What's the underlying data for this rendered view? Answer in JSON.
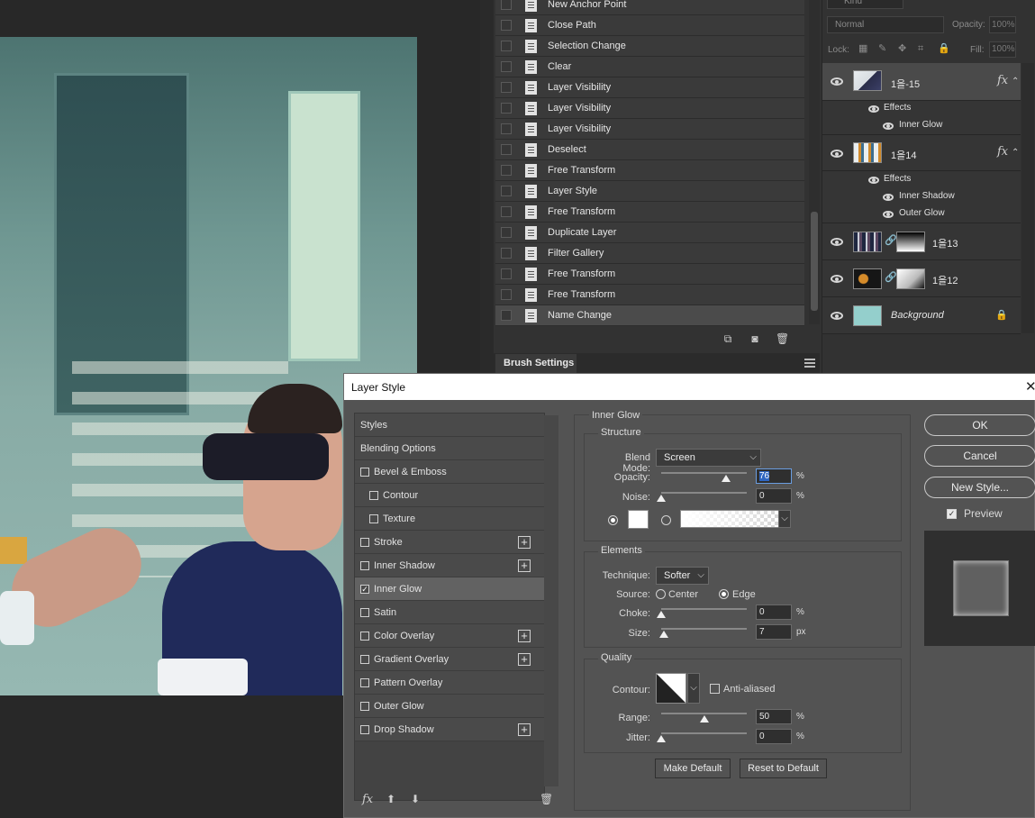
{
  "history": {
    "items": [
      "New Anchor Point",
      "Close Path",
      "Selection Change",
      "Clear",
      "Layer Visibility",
      "Layer Visibility",
      "Layer Visibility",
      "Deselect",
      "Free Transform",
      "Layer Style",
      "Free Transform",
      "Duplicate Layer",
      "Filter Gallery",
      "Free Transform",
      "Free Transform",
      "Name Change"
    ],
    "selected_index": 15,
    "brush_tab": "Brush Settings"
  },
  "layers": {
    "kind": "Kind",
    "blend_mode": "Normal",
    "opacity_label": "Opacity:",
    "opacity_value": "100%",
    "lock_label": "Lock:",
    "fill_label": "Fill:",
    "fill_value": "100%",
    "items": [
      {
        "name": "1을-15",
        "fx": "fx",
        "effects_label": "Effects",
        "effects": [
          "Inner Glow"
        ]
      },
      {
        "name": "1을14",
        "fx": "fx",
        "effects_label": "Effects",
        "effects": [
          "Inner Shadow",
          "Outer Glow"
        ]
      },
      {
        "name": "1을13"
      },
      {
        "name": "1을12"
      },
      {
        "name": "Background"
      }
    ]
  },
  "dialog": {
    "title": "Layer Style",
    "styles": [
      {
        "label": "Styles",
        "checkbox": false,
        "plus": false
      },
      {
        "label": "Blending Options",
        "checkbox": false,
        "plus": false
      },
      {
        "label": "Bevel & Emboss",
        "checkbox": true,
        "checked": false,
        "plus": false
      },
      {
        "label": "Contour",
        "checkbox": true,
        "checked": false,
        "plus": false,
        "indent": true
      },
      {
        "label": "Texture",
        "checkbox": true,
        "checked": false,
        "plus": false,
        "indent": true
      },
      {
        "label": "Stroke",
        "checkbox": true,
        "checked": false,
        "plus": true
      },
      {
        "label": "Inner Shadow",
        "checkbox": true,
        "checked": false,
        "plus": true
      },
      {
        "label": "Inner Glow",
        "checkbox": true,
        "checked": true,
        "plus": false,
        "active": true
      },
      {
        "label": "Satin",
        "checkbox": true,
        "checked": false,
        "plus": false
      },
      {
        "label": "Color Overlay",
        "checkbox": true,
        "checked": false,
        "plus": true
      },
      {
        "label": "Gradient Overlay",
        "checkbox": true,
        "checked": false,
        "plus": true
      },
      {
        "label": "Pattern Overlay",
        "checkbox": true,
        "checked": false,
        "plus": false
      },
      {
        "label": "Outer Glow",
        "checkbox": true,
        "checked": false,
        "plus": false
      },
      {
        "label": "Drop Shadow",
        "checkbox": true,
        "checked": false,
        "plus": true
      }
    ],
    "panel_title": "Inner Glow",
    "structure": {
      "title": "Structure",
      "blend_mode_label": "Blend Mode:",
      "blend_mode": "Screen",
      "opacity_label": "Opacity:",
      "opacity": "76",
      "opacity_level": 0.76,
      "noise_label": "Noise:",
      "noise": "0",
      "noise_level": 0,
      "unit": "%"
    },
    "elements": {
      "title": "Elements",
      "technique_label": "Technique:",
      "technique": "Softer",
      "source_label": "Source:",
      "source_center": "Center",
      "source_edge": "Edge",
      "choke_label": "Choke:",
      "choke": "0",
      "choke_level": 0,
      "size_label": "Size:",
      "size": "7",
      "size_level": 0.03,
      "unit_percent": "%",
      "unit_px": "px"
    },
    "quality": {
      "title": "Quality",
      "contour_label": "Contour:",
      "anti_aliased": "Anti-aliased",
      "range_label": "Range:",
      "range": "50",
      "range_level": 0.5,
      "jitter_label": "Jitter:",
      "jitter": "0",
      "jitter_level": 0,
      "unit": "%"
    },
    "make_default": "Make Default",
    "reset_default": "Reset to Default",
    "ok": "OK",
    "cancel": "Cancel",
    "new_style": "New Style...",
    "preview": "Preview"
  }
}
